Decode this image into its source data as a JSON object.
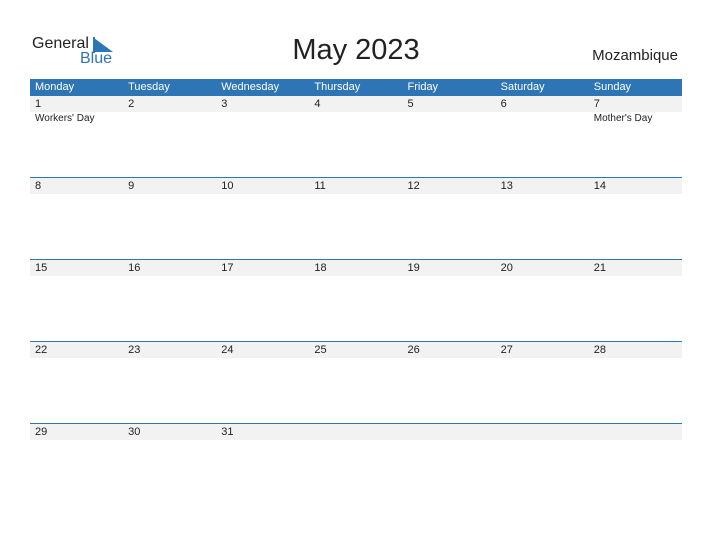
{
  "brand": {
    "line1": "General",
    "line2": "Blue",
    "accent": "#2e75b6"
  },
  "title": "May 2023",
  "country": "Mozambique",
  "weekdays": [
    "Monday",
    "Tuesday",
    "Wednesday",
    "Thursday",
    "Friday",
    "Saturday",
    "Sunday"
  ],
  "weeks": [
    {
      "days": [
        "1",
        "2",
        "3",
        "4",
        "5",
        "6",
        "7"
      ],
      "holidays": [
        "Workers' Day",
        "",
        "",
        "",
        "",
        "",
        "Mother's Day"
      ]
    },
    {
      "days": [
        "8",
        "9",
        "10",
        "11",
        "12",
        "13",
        "14"
      ],
      "holidays": [
        "",
        "",
        "",
        "",
        "",
        "",
        ""
      ]
    },
    {
      "days": [
        "15",
        "16",
        "17",
        "18",
        "19",
        "20",
        "21"
      ],
      "holidays": [
        "",
        "",
        "",
        "",
        "",
        "",
        ""
      ]
    },
    {
      "days": [
        "22",
        "23",
        "24",
        "25",
        "26",
        "27",
        "28"
      ],
      "holidays": [
        "",
        "",
        "",
        "",
        "",
        "",
        ""
      ]
    },
    {
      "days": [
        "29",
        "30",
        "31",
        "",
        "",
        "",
        ""
      ],
      "holidays": [
        "",
        "",
        "",
        "",
        "",
        "",
        ""
      ]
    }
  ]
}
